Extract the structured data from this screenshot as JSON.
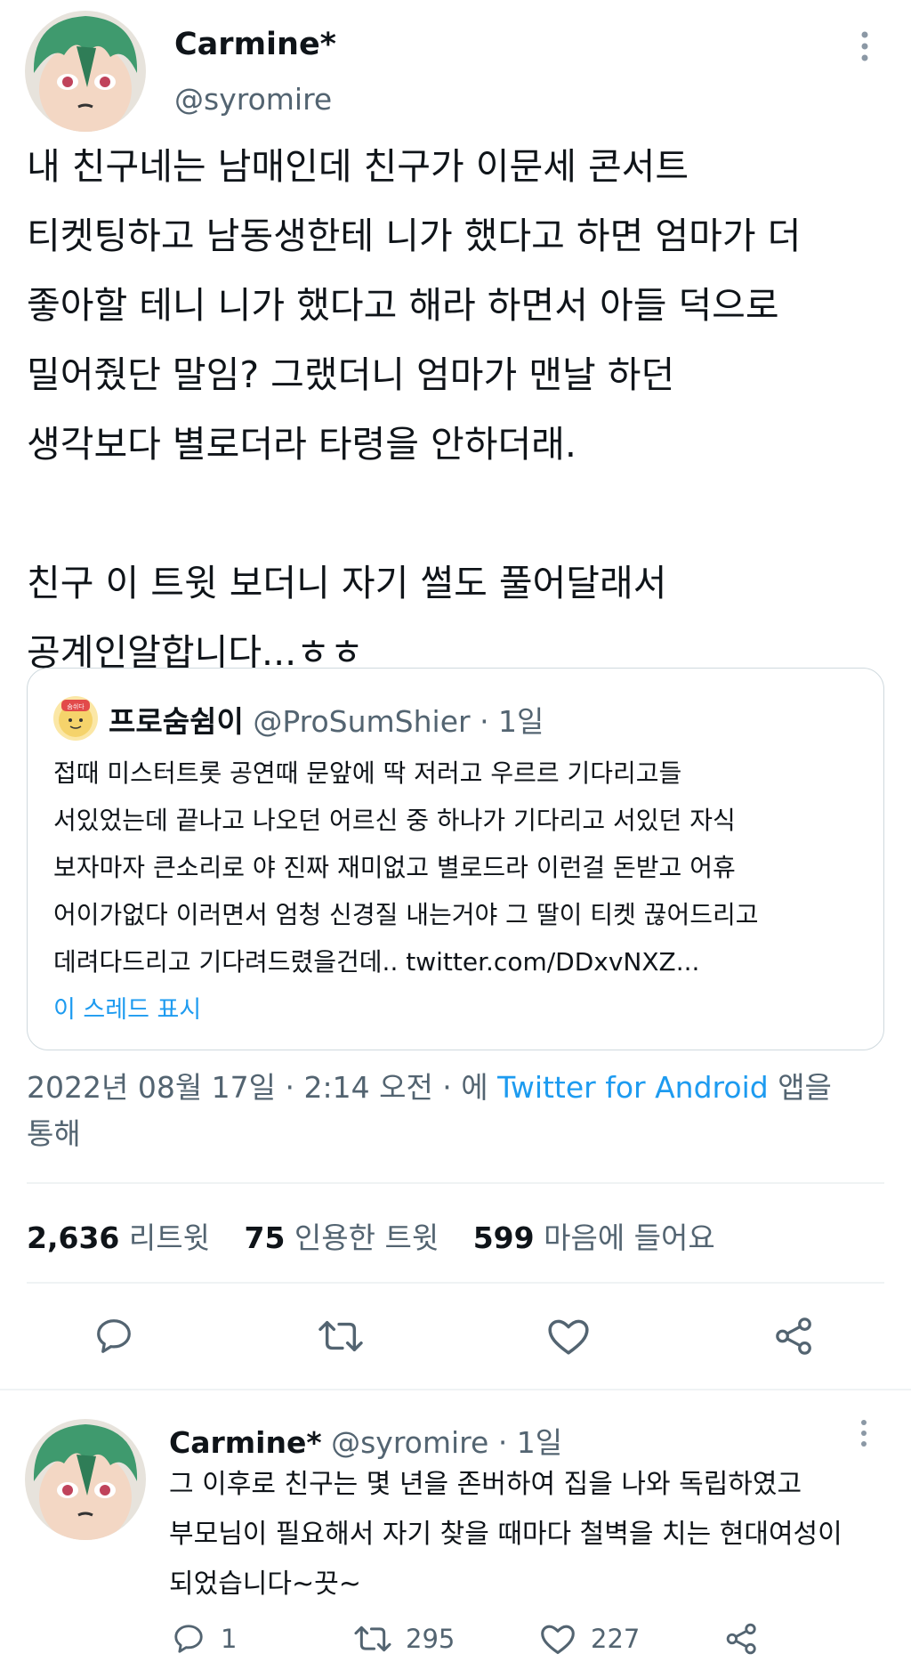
{
  "main_tweet": {
    "author_name": "Carmine*",
    "author_handle": "@syromire",
    "text": "내 친구네는 남매인데 친구가 이문세 콘서트\n티켓팅하고 남동생한테 니가 했다고 하면 엄마가 더\n좋아할 테니 니가 했다고 해라 하면서 아들 덕으로\n밀어줬단 말임? 그랬더니 엄마가 맨날 하던\n생각보다 별로더라 타령을 안하더래.\n\n친구 이 트윗 보더니 자기 썰도 풀어달래서\n공계인알합니다...ㅎㅎ",
    "date": "2022년 08월 17일 · 2:14 오전 · 에",
    "source_link": "Twitter for Android",
    "source_suffix": "앱을",
    "via": "통해"
  },
  "quote": {
    "author_name": "프로숨쉼이",
    "author_handle": "@ProSumShier",
    "time": "· 1일",
    "avatar_label": "숨쉬다",
    "text": "접때 미스터트롯 공연때 문앞에 딱 저러고 우르르 기다리고들\n서있었는데 끝나고 나오던 어르신 중 하나가 기다리고 서있던 자식\n보자마자 큰소리로 야 진짜 재미없고 별로드라 이런걸 돈받고 어휴\n어이가없다 이러면서 엄청 신경질 내는거야 그 딸이 티켓 끊어드리고\n데려다드리고 기다려드렸을건데.. twitter.com/DDxvNXZ...",
    "thread_link": "이 스레드 표시"
  },
  "stats": {
    "retweets_count": "2,636",
    "retweets_label": "리트윗",
    "quotes_count": "75",
    "quotes_label": "인용한 트윗",
    "likes_count": "599",
    "likes_label": "마음에 들어요"
  },
  "reply": {
    "author_name": "Carmine*",
    "author_handle": "@syromire",
    "time": "· 1일",
    "text": "그 이후로 친구는 몇 년을 존버하여 집을 나와 독립하였고\n부모님이 필요해서 자기 찾을 때마다 철벽을 치는 현대여성이\n되었습니다~끗~",
    "reply_count": "1",
    "retweet_count": "295",
    "like_count": "227"
  },
  "icons": {
    "more": "more-vertical-icon",
    "reply": "reply-bubble-icon",
    "retweet": "retweet-icon",
    "like": "heart-icon",
    "share": "share-icon"
  },
  "colors": {
    "accent": "#1d9bf0",
    "secondary_text": "#536471",
    "primary_text": "#0f1419",
    "avatar_hair": "#3f9a6e"
  }
}
